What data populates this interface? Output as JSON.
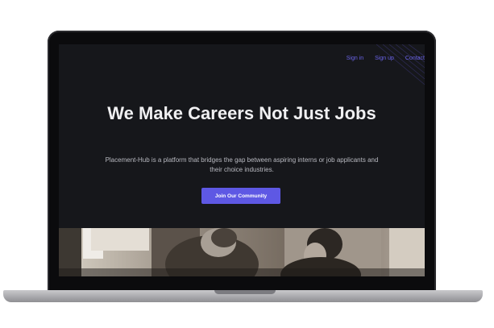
{
  "nav": {
    "items": [
      {
        "label": "Sign in"
      },
      {
        "label": "Sign up"
      },
      {
        "label": "Contact"
      }
    ]
  },
  "hero": {
    "title": "We Make Careers Not Just Jobs",
    "subtitle": "Placement-Hub is a platform that bridges the gap between aspiring interns or job applicants and their choice industries.",
    "cta_label": "Join Our Community"
  },
  "colors": {
    "accent": "#5e58e4",
    "nav_link": "#6a63e6",
    "screen_background": "#16171b"
  }
}
